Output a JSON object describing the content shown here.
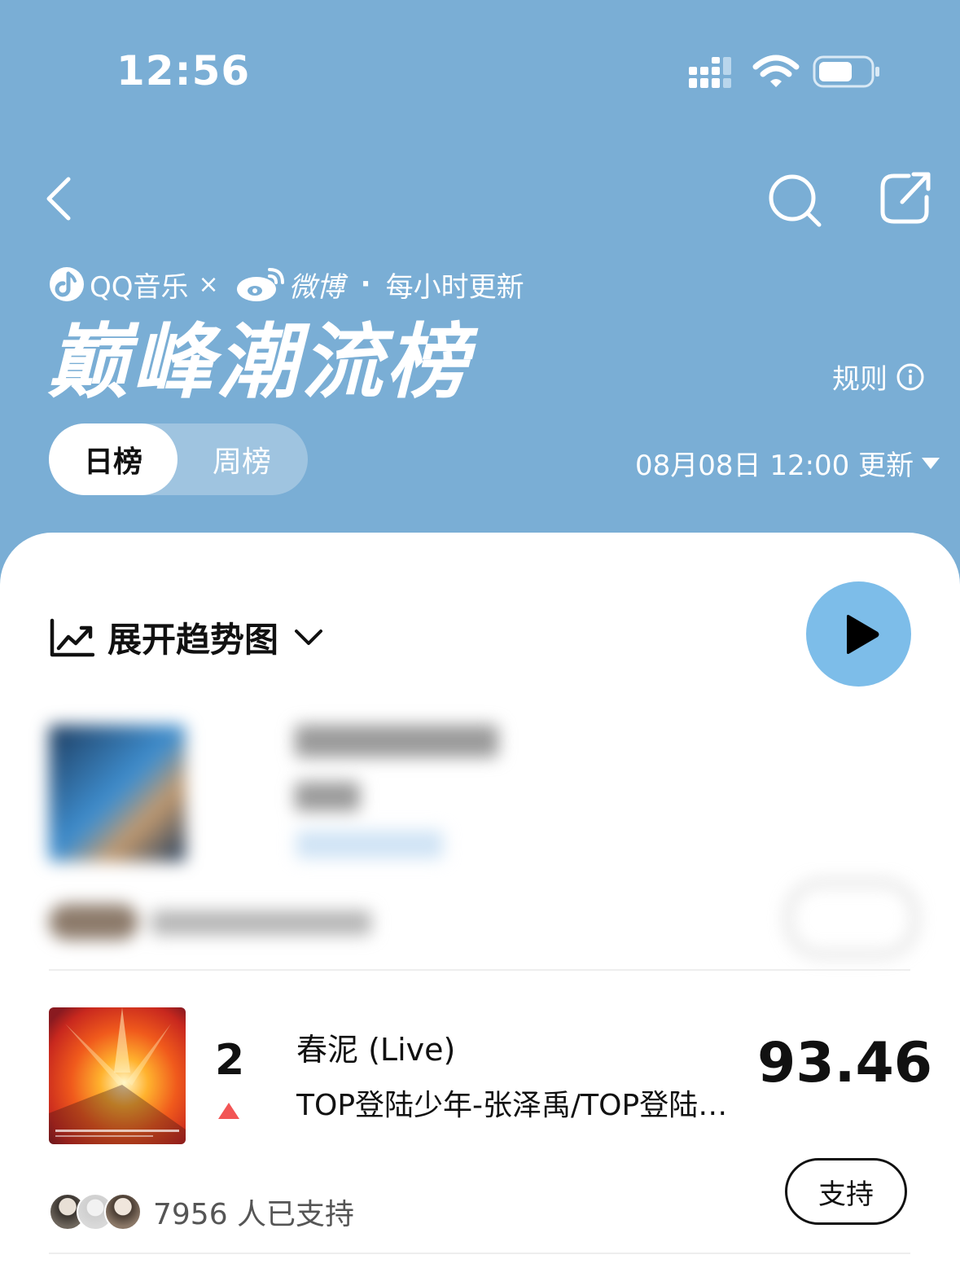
{
  "status_bar": {
    "time": "12:56"
  },
  "brand": {
    "qq_music": "QQ音乐",
    "times": "×",
    "weibo": "微博",
    "dot": "·",
    "frequency": "每小时更新"
  },
  "title": "巅峰潮流榜",
  "rules_label": "规则",
  "tabs": [
    {
      "label": "日榜",
      "active": true
    },
    {
      "label": "周榜",
      "active": false
    }
  ],
  "update_time": "08月08日 12:00 更新",
  "trend_toggle_label": "展开趋势图",
  "colors": {
    "header": "#7aaed5",
    "play_button": "#7dbde9",
    "up_arrow": "#f25555"
  },
  "rows": [
    {
      "rank": "2",
      "trend": "up",
      "song": "春泥 (Live)",
      "artist": "TOP登陆少年-张泽禹/TOP登陆少年-邓佳鑫",
      "score": "93.46",
      "supporters": "7956 人已支持",
      "support_label": "支持"
    }
  ]
}
